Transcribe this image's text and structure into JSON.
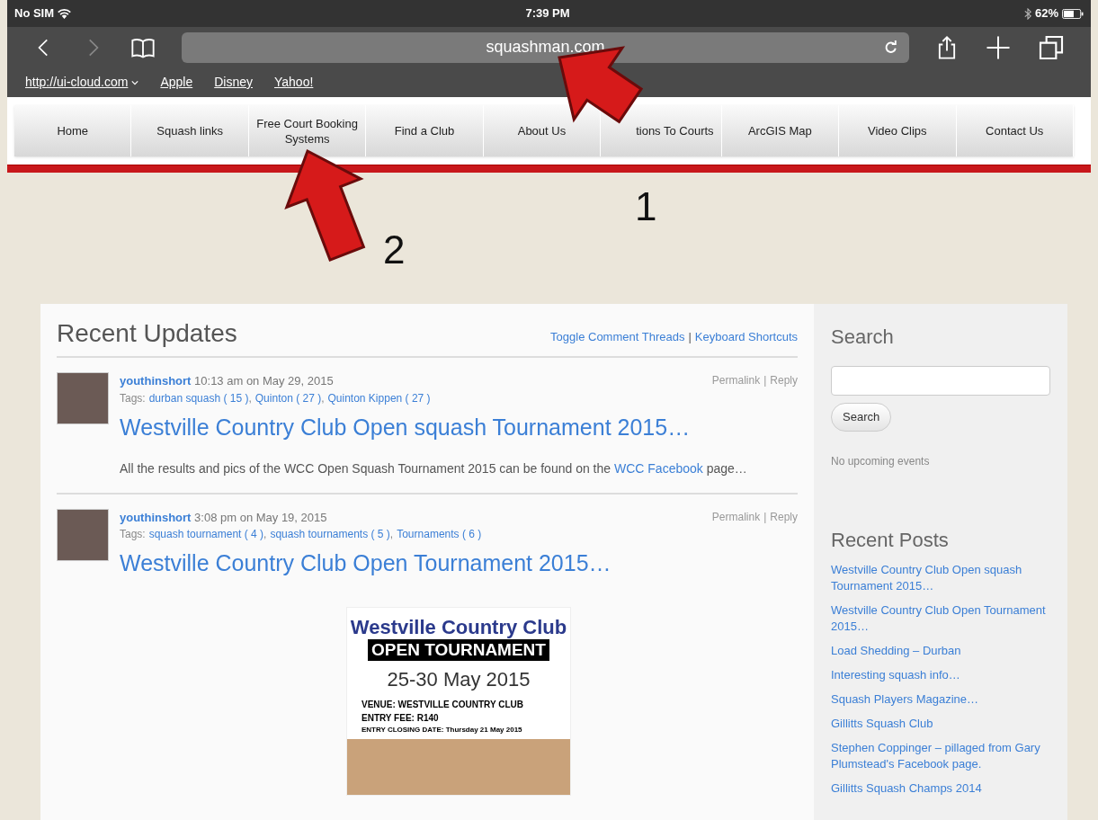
{
  "status_bar": {
    "carrier": "No SIM",
    "time": "7:39 PM",
    "battery": "62%"
  },
  "browser": {
    "url": "squashman.com",
    "bookmarks": [
      {
        "label": "http://ui-cloud.com",
        "menu": true
      },
      {
        "label": "Apple",
        "menu": false
      },
      {
        "label": "Disney",
        "menu": false
      },
      {
        "label": "Yahoo!",
        "menu": false
      }
    ]
  },
  "separators": {
    "pipe": "|",
    "comma": ","
  },
  "nav": [
    "Home",
    "Squash links",
    "Free Court Booking Systems",
    "Find a Club",
    "About Us",
    "tions To Courts",
    "ArcGIS Map",
    "Video Clips",
    "Contact Us"
  ],
  "annotations": [
    {
      "label": "1"
    },
    {
      "label": "2"
    }
  ],
  "main": {
    "title": "Recent Updates",
    "links": [
      "Toggle Comment Threads",
      "Keyboard Shortcuts"
    ],
    "posts": [
      {
        "author": "youthinshort",
        "time": "10:13 am on May 29, 2015",
        "tags_label": "Tags:",
        "tags": [
          "durban squash ( 15 )",
          "Quinton ( 27 )",
          "Quinton Kippen ( 27 )"
        ],
        "actions": [
          "Permalink",
          "Reply"
        ],
        "title": "Westville Country Club Open squash Tournament 2015…",
        "excerpt": "All the results and pics of the WCC Open Squash Tournament 2015 can be found on the ",
        "excerpt_link": "WCC Facebook",
        "excerpt_end": " page…"
      },
      {
        "author": "youthinshort",
        "time": "3:08 pm on May 19, 2015",
        "tags_label": "Tags:",
        "tags": [
          "squash tournament ( 4 )",
          "squash tournaments ( 5 )",
          "Tournaments ( 6 )"
        ],
        "actions": [
          "Permalink",
          "Reply"
        ],
        "title": "Westville Country Club Open Tournament 2015…",
        "poster": {
          "club": "Westville Country Club",
          "event": "OPEN TOURNAMENT",
          "dates": "25-30 May 2015",
          "venue": "VENUE: WESTVILLE COUNTRY CLUB",
          "fee": "ENTRY FEE: R140",
          "closing": "ENTRY CLOSING DATE: Thursday 21 May 2015"
        }
      }
    ]
  },
  "sidebar": {
    "search_title": "Search",
    "search_button": "Search",
    "events": "No upcoming events",
    "recent_title": "Recent Posts",
    "recent": [
      "Westville Country Club Open squash Tournament 2015…",
      "Westville Country Club Open Tournament 2015…",
      "Load Shedding – Durban",
      "Interesting squash info…",
      "Squash Players Magazine…",
      "Gillitts Squash Club",
      "Stephen Coppinger – pillaged from Gary Plumstead's Facebook page.",
      "Gillitts Squash Champs 2014"
    ]
  }
}
